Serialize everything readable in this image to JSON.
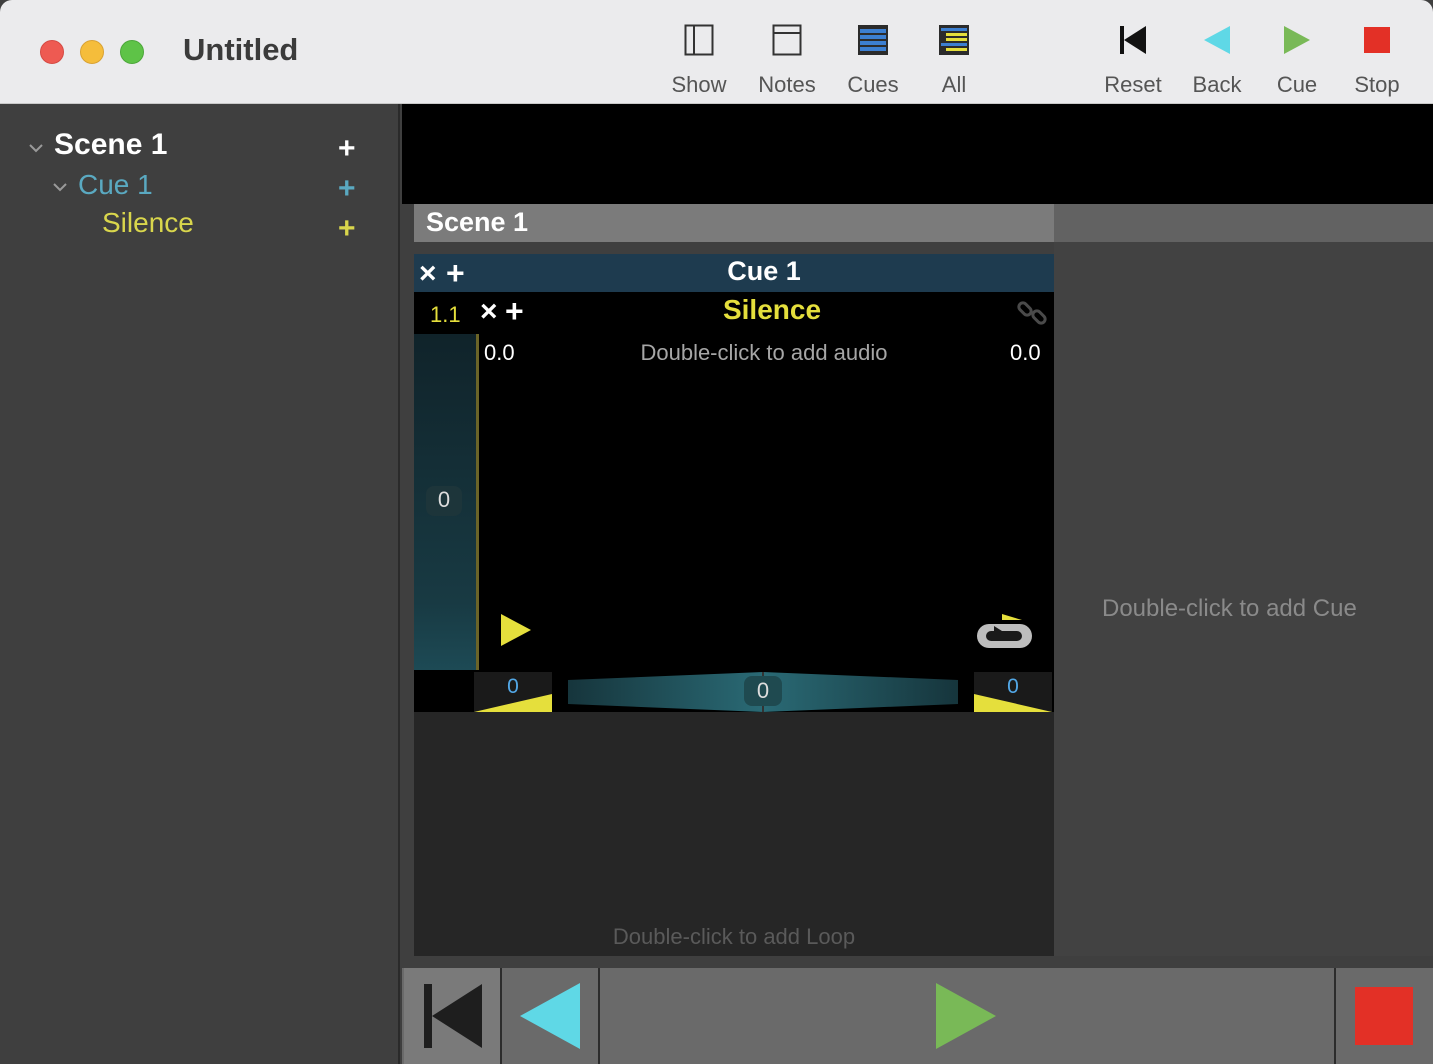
{
  "window": {
    "title": "Untitled"
  },
  "toolbar": {
    "view_buttons": [
      {
        "label": "Show",
        "icon": "sidebar-layout-icon"
      },
      {
        "label": "Notes",
        "icon": "notes-layout-icon"
      },
      {
        "label": "Cues",
        "icon": "cues-layout-icon"
      },
      {
        "label": "All",
        "icon": "all-layout-icon"
      }
    ],
    "transport_buttons": [
      {
        "label": "Reset",
        "icon": "skip-back-icon",
        "color": "#111111"
      },
      {
        "label": "Back",
        "icon": "back-triangle-icon",
        "color": "#5fd8e6"
      },
      {
        "label": "Cue",
        "icon": "play-triangle-icon",
        "color": "#79b957"
      },
      {
        "label": "Stop",
        "icon": "stop-square-icon",
        "color": "#e33026"
      }
    ]
  },
  "sidebar": {
    "scene": {
      "label": "Scene 1",
      "add": "+"
    },
    "cue": {
      "label": "Cue 1",
      "add": "+"
    },
    "item": {
      "label": "Silence",
      "add": "+"
    }
  },
  "main": {
    "scene_header": "Scene 1",
    "cue_header": {
      "title": "Cue 1",
      "close": "×",
      "add": "+"
    },
    "track": {
      "number": "1.1",
      "close": "×",
      "add": "+",
      "name": "Silence",
      "start_time": "0.0",
      "end_time": "0.0",
      "audio_hint": "Double-click to add audio",
      "level": "0",
      "fade_in": "0",
      "pan": "0",
      "fade_out": "0"
    },
    "loop_hint": "Double-click to add Loop",
    "add_cue_hint": "Double-click to add Cue"
  },
  "colors": {
    "scene": "#ffffff",
    "cue": "#5aa9c1",
    "track": "#d9d64c",
    "accent_yellow": "#e5df3c"
  }
}
